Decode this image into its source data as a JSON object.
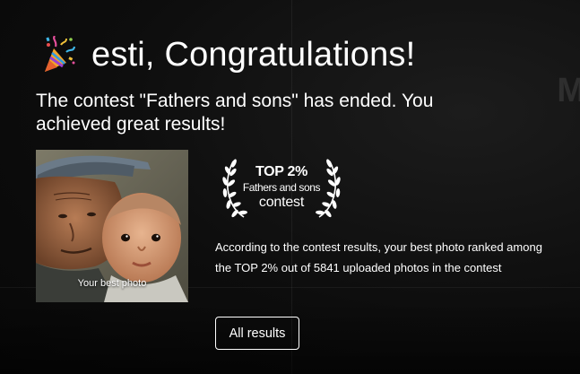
{
  "heading": {
    "icon": "party-popper-icon",
    "title": "esti, Congratulations!"
  },
  "subtitle": "The contest \"Fathers and sons\" has ended. You achieved great results!",
  "photo": {
    "caption": "Your best photo"
  },
  "award": {
    "rank": "TOP 2%",
    "contest_name": "Fathers and sons",
    "contest_word": "contest",
    "icon": "laurel-wreath-icon"
  },
  "description": "According to the contest results, your best photo ranked among the TOP 2% out of 5841 uploaded photos in the contest",
  "button": {
    "label": "All results"
  },
  "background": {
    "letter": "M"
  },
  "colors": {
    "background": "#0b0b0b",
    "text": "#ffffff",
    "button_border": "#ffffff"
  }
}
